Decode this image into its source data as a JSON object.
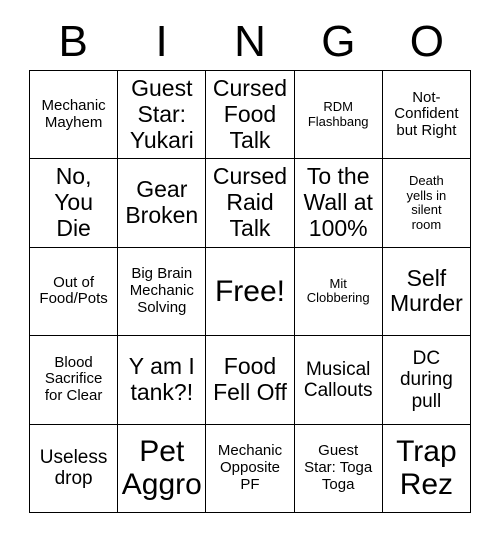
{
  "card": {
    "header_letters": [
      "B",
      "I",
      "N",
      "G",
      "O"
    ],
    "columns": 5,
    "rows": 5,
    "cells": [
      {
        "text": "Mechanic\nMayhem",
        "size": "sz-sm"
      },
      {
        "text": "Guest\nStar:\nYukari",
        "size": "sz-lg"
      },
      {
        "text": "Cursed\nFood\nTalk",
        "size": "sz-lg"
      },
      {
        "text": "RDM\nFlashbang",
        "size": "sz-xs"
      },
      {
        "text": "Not-\nConfident\nbut Right",
        "size": "sz-sm"
      },
      {
        "text": "No,\nYou\nDie",
        "size": "sz-lg"
      },
      {
        "text": "Gear\nBroken",
        "size": "sz-lg"
      },
      {
        "text": "Cursed\nRaid\nTalk",
        "size": "sz-lg"
      },
      {
        "text": "To the\nWall at\n100%",
        "size": "sz-lg"
      },
      {
        "text": "Death\nyells in\nsilent\nroom",
        "size": "sz-xs"
      },
      {
        "text": "Out of\nFood/Pots",
        "size": "sz-sm"
      },
      {
        "text": "Big Brain\nMechanic\nSolving",
        "size": "sz-sm"
      },
      {
        "text": "Free!",
        "size": "sz-xl"
      },
      {
        "text": "Mit\nClobbering",
        "size": "sz-xs"
      },
      {
        "text": "Self\nMurder",
        "size": "sz-lg"
      },
      {
        "text": "Blood\nSacrifice\nfor Clear",
        "size": "sz-sm"
      },
      {
        "text": "Y am I\ntank?!",
        "size": "sz-lg"
      },
      {
        "text": "Food\nFell Off",
        "size": "sz-lg"
      },
      {
        "text": "Musical\nCallouts",
        "size": "sz-md"
      },
      {
        "text": "DC\nduring\npull",
        "size": "sz-md"
      },
      {
        "text": "Useless\ndrop",
        "size": "sz-md"
      },
      {
        "text": "Pet\nAggro",
        "size": "sz-xl"
      },
      {
        "text": "Mechanic\nOpposite\nPF",
        "size": "sz-sm"
      },
      {
        "text": "Guest\nStar: Toga\nToga",
        "size": "sz-sm"
      },
      {
        "text": "Trap\nRez",
        "size": "sz-xl"
      }
    ]
  }
}
